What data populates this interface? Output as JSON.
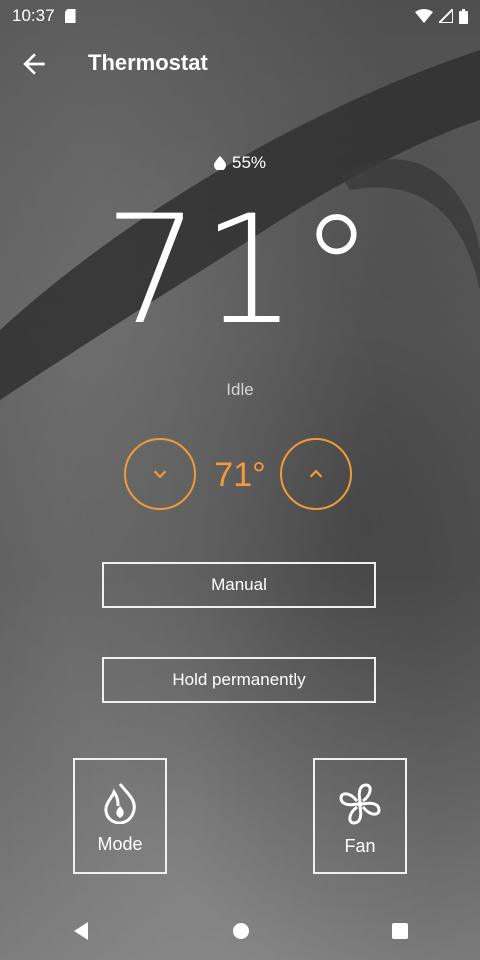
{
  "status_bar": {
    "time": "10:37"
  },
  "app_bar": {
    "title": "Thermostat"
  },
  "humidity": "55%",
  "current_temperature": "71°",
  "hvac_state": "Idle",
  "setpoint": "71°",
  "buttons": {
    "preset": "Manual",
    "hold": "Hold permanently",
    "mode": "Mode",
    "fan": "Fan"
  },
  "colors": {
    "accent": "#f29a3a",
    "outline": "#f0f0f0"
  },
  "icons": {
    "back": "arrow-left-icon",
    "humidity": "water-drop-icon",
    "down": "chevron-down-icon",
    "up": "chevron-up-icon",
    "mode": "flame-icon",
    "fan": "fan-icon"
  }
}
